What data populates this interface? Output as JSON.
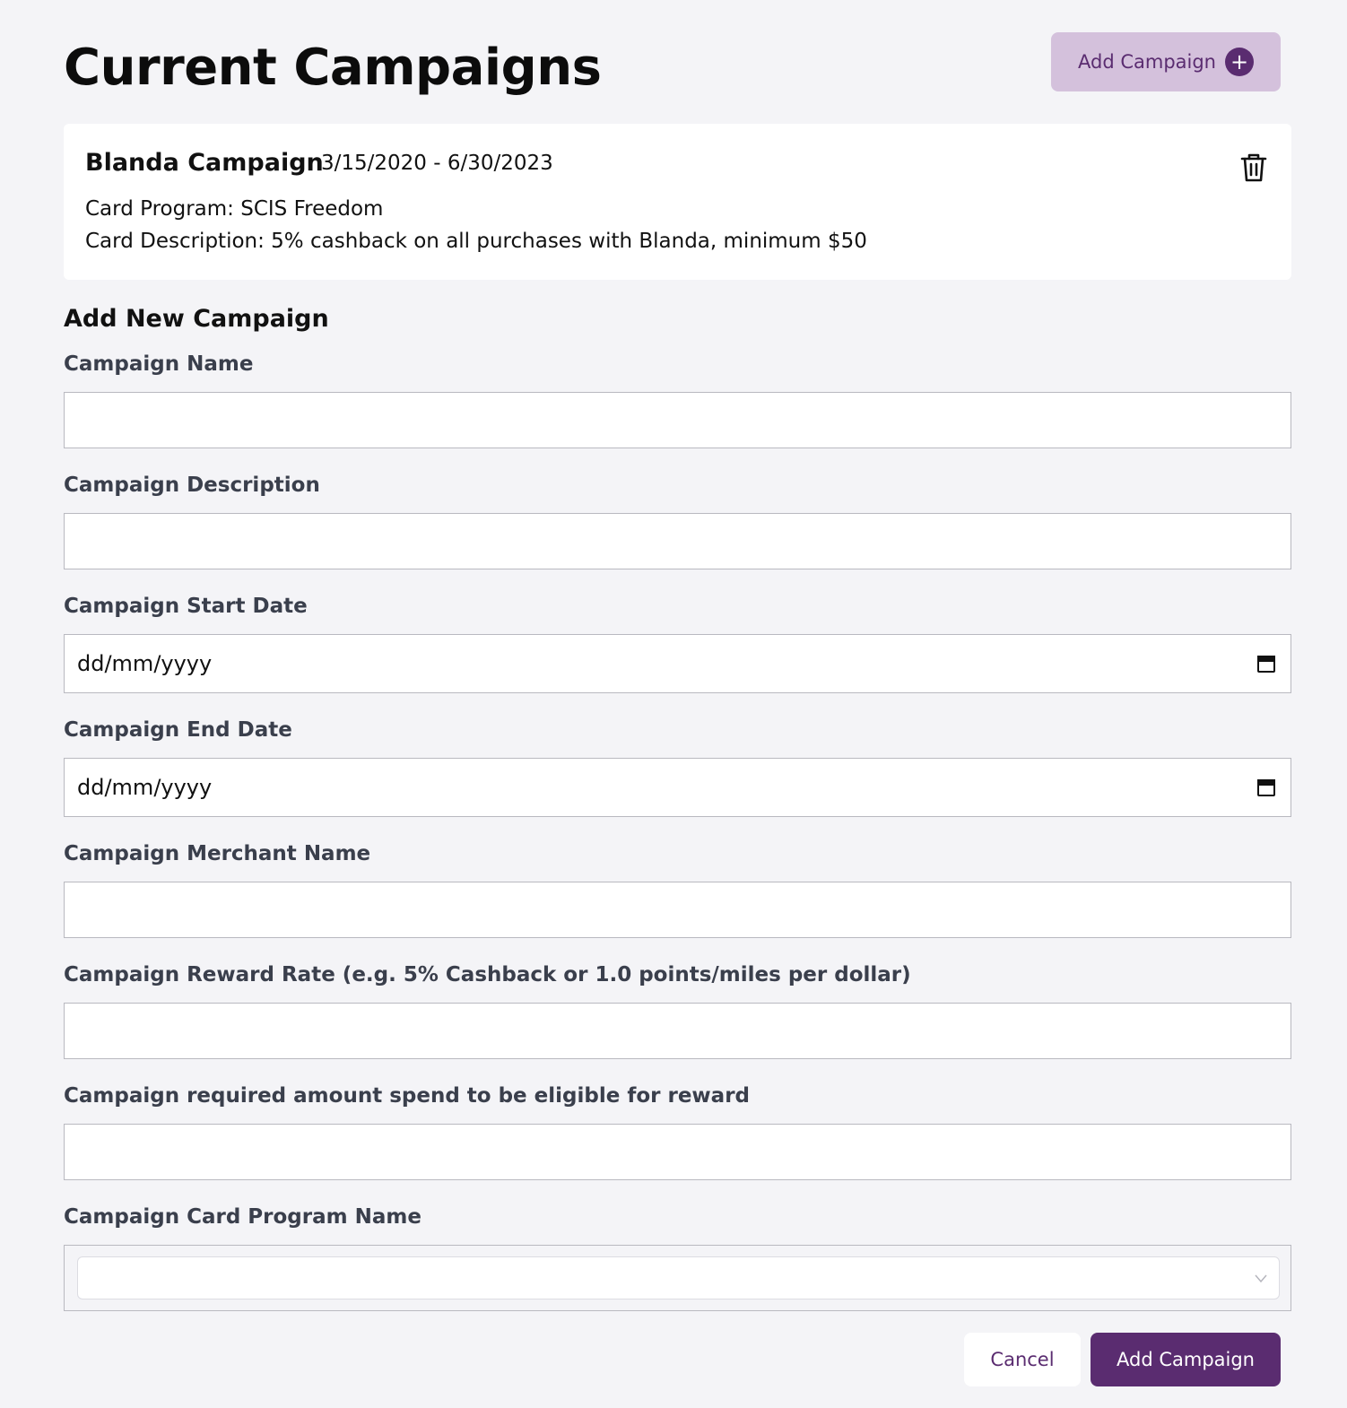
{
  "header": {
    "title": "Current Campaigns",
    "add_button_label": "Add Campaign"
  },
  "campaigns": [
    {
      "name": "Blanda Campaign",
      "dates": "3/15/2020 - 6/30/2023",
      "card_program": "Card Program: SCIS Freedom",
      "card_description": "Card Description: 5% cashback on all purchases with Blanda, minimum $50"
    }
  ],
  "form": {
    "title": "Add New Campaign",
    "fields": {
      "name": {
        "label": "Campaign Name",
        "value": ""
      },
      "description": {
        "label": "Campaign Description",
        "value": ""
      },
      "start_date": {
        "label": "Campaign Start Date",
        "placeholder": "dd/mm/yyyy"
      },
      "end_date": {
        "label": "Campaign End Date",
        "placeholder": "dd/mm/yyyy"
      },
      "merchant": {
        "label": "Campaign Merchant Name",
        "value": ""
      },
      "reward_rate": {
        "label": "Campaign Reward Rate (e.g. 5% Cashback or 1.0 points/miles per dollar)",
        "value": ""
      },
      "min_spend": {
        "label": "Campaign required amount spend to be eligible for reward",
        "value": ""
      },
      "card_program": {
        "label": "Campaign Card Program Name",
        "value": ""
      }
    },
    "cancel_label": "Cancel",
    "submit_label": "Add Campaign"
  },
  "colors": {
    "primary": "#5a2c70",
    "primary_light": "#d4c1dc",
    "background": "#f4f4f7",
    "label": "#3a3f4c"
  },
  "icons": {
    "add": "plus-circle-icon",
    "delete": "trash-icon",
    "calendar": "calendar-icon",
    "dropdown": "chevron-down-icon"
  }
}
